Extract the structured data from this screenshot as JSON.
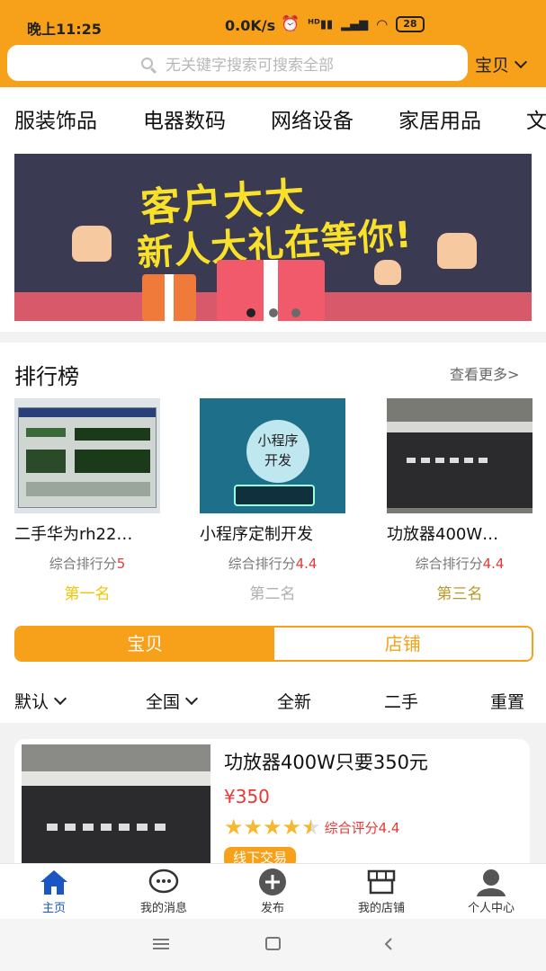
{
  "status_bar": {
    "time": "晚上11:25",
    "net_speed": "0.0K/s",
    "battery": "28",
    "icons": [
      "alarm-icon",
      "hd-signal-icon",
      "signal-icon",
      "wifi-icon",
      "battery-icon"
    ]
  },
  "search": {
    "placeholder": "无关键字搜索可搜索全部",
    "scope": "宝贝"
  },
  "categories": [
    "服装饰品",
    "电器数码",
    "网络设备",
    "家居用品",
    "文"
  ],
  "banner": {
    "line1": "客户大大",
    "line2": "新人大礼在等你!",
    "active_dot": 0,
    "dot_count": 3
  },
  "ranking": {
    "title": "排行榜",
    "more": "查看更多>",
    "score_label": "综合排行分",
    "items": [
      {
        "name": "二手华为rh22…",
        "score": "5",
        "place": "第一名",
        "place_color": "#f5c400"
      },
      {
        "name": "小程序定制开发",
        "score": "4.4",
        "place": "第二名",
        "place_color": "#b0b0b0",
        "thumb_text_1": "小程序",
        "thumb_text_2": "开发"
      },
      {
        "name": "功放器400W…",
        "score": "4.4",
        "place": "第三名",
        "place_color": "#b89a2a"
      }
    ]
  },
  "segment": {
    "items": [
      "宝贝",
      "店铺"
    ],
    "active": 0
  },
  "filters": [
    "默认",
    "全国",
    "全新",
    "二手",
    "重置"
  ],
  "product": {
    "name": "功放器400W只要350元",
    "price": "¥350",
    "rating": 4.4,
    "rating_label": "综合评分4.4",
    "tag": "线下交易"
  },
  "tabbar": {
    "active": 0,
    "items": [
      {
        "label": "主页",
        "icon": "home-icon"
      },
      {
        "label": "我的消息",
        "icon": "message-icon"
      },
      {
        "label": "发布",
        "icon": "plus-icon"
      },
      {
        "label": "我的店铺",
        "icon": "store-icon"
      },
      {
        "label": "个人中心",
        "icon": "user-icon"
      }
    ]
  },
  "colors": {
    "accent": "#f7a11a",
    "price": "#e53935",
    "tab_active": "#1a56c4"
  }
}
